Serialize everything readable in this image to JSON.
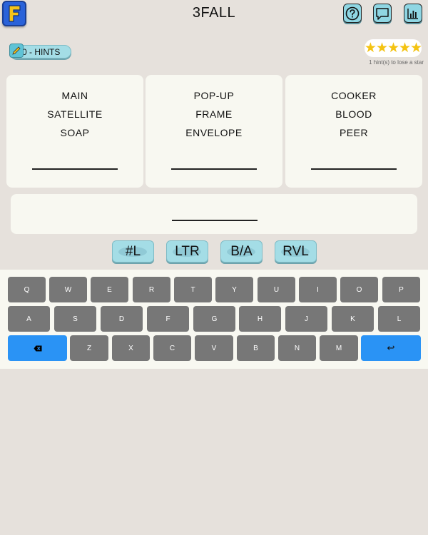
{
  "header": {
    "title": "3FALL",
    "logo_letter": "F"
  },
  "hints": {
    "label": "0 - HINTS"
  },
  "rating": {
    "stars": "★★★★★",
    "star_count": 5,
    "note": "1 hint(s) to lose a star"
  },
  "clues": [
    {
      "words": [
        "MAIN",
        "SATELLITE",
        "SOAP"
      ]
    },
    {
      "words": [
        "POP-UP",
        "FRAME",
        "ENVELOPE"
      ]
    },
    {
      "words": [
        "COOKER",
        "BLOOD",
        "PEER"
      ]
    }
  ],
  "actions": [
    "#L",
    "LTR",
    "B/A",
    "RVL"
  ],
  "keyboard": {
    "row1": [
      "Q",
      "W",
      "E",
      "R",
      "T",
      "Y",
      "U",
      "I",
      "O",
      "P"
    ],
    "row2": [
      "A",
      "S",
      "D",
      "F",
      "G",
      "H",
      "J",
      "K",
      "L"
    ],
    "row3": [
      "Z",
      "X",
      "C",
      "V",
      "B",
      "N",
      "M"
    ],
    "backspace_icon": "backspace-icon",
    "enter_glyph": "↩"
  },
  "colors": {
    "background": "#e6e1dc",
    "accent": "#a4dde6",
    "key": "#777777",
    "key_blue": "#2a93f5",
    "star": "#f4c312"
  }
}
